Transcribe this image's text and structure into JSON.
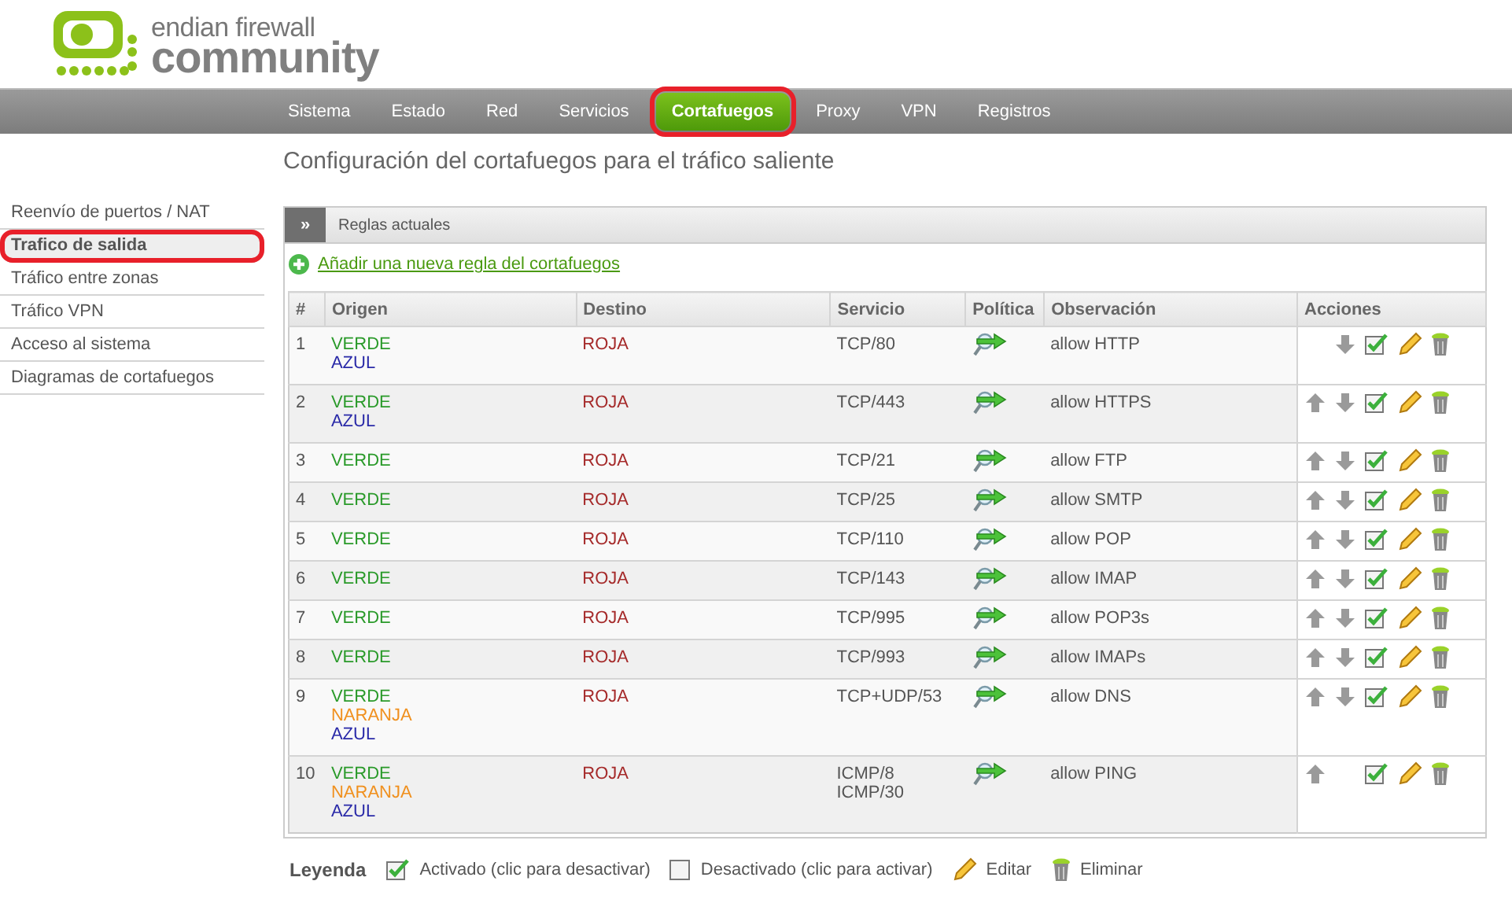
{
  "logo": {
    "line1": "endian firewall",
    "line2": "community"
  },
  "nav": [
    {
      "label": "Sistema",
      "selected": false,
      "highlighted": false
    },
    {
      "label": "Estado",
      "selected": false,
      "highlighted": false
    },
    {
      "label": "Red",
      "selected": false,
      "highlighted": false
    },
    {
      "label": "Servicios",
      "selected": false,
      "highlighted": false
    },
    {
      "label": "Cortafuegos",
      "selected": true,
      "highlighted": true
    },
    {
      "label": "Proxy",
      "selected": false,
      "highlighted": false
    },
    {
      "label": "VPN",
      "selected": false,
      "highlighted": false
    },
    {
      "label": "Registros",
      "selected": false,
      "highlighted": false
    }
  ],
  "page_title": "Configuración del cortafuegos para el tráfico saliente",
  "sidebar": [
    {
      "label": "Reenvío de puertos / NAT",
      "selected": false,
      "highlighted": false
    },
    {
      "label": "Trafico de salida",
      "selected": true,
      "highlighted": true
    },
    {
      "label": "Tráfico entre zonas",
      "selected": false,
      "highlighted": false
    },
    {
      "label": "Tráfico VPN",
      "selected": false,
      "highlighted": false
    },
    {
      "label": "Acceso al sistema",
      "selected": false,
      "highlighted": false
    },
    {
      "label": "Diagramas de cortafuegos",
      "selected": false,
      "highlighted": false
    }
  ],
  "panel": {
    "toggle": "»",
    "title": "Reglas actuales",
    "add_link": "Añadir una nueva regla del cortafuegos"
  },
  "table": {
    "columns": [
      "#",
      "Origen",
      "Destino",
      "Servicio",
      "Política",
      "Observación",
      "Acciones"
    ],
    "rows": [
      {
        "num": "1",
        "origin": [
          {
            "label": "VERDE",
            "color": "#2a9a2a"
          },
          {
            "label": "AZUL",
            "color": "#2a2aa8"
          }
        ],
        "destination": [
          {
            "label": "ROJA",
            "color": "#a52a2a"
          }
        ],
        "service": [
          "TCP/80"
        ],
        "note": "allow HTTP",
        "can_move_up": false,
        "can_move_down": true,
        "enabled": true
      },
      {
        "num": "2",
        "origin": [
          {
            "label": "VERDE",
            "color": "#2a9a2a"
          },
          {
            "label": "AZUL",
            "color": "#2a2aa8"
          }
        ],
        "destination": [
          {
            "label": "ROJA",
            "color": "#a52a2a"
          }
        ],
        "service": [
          "TCP/443"
        ],
        "note": "allow HTTPS",
        "can_move_up": true,
        "can_move_down": true,
        "enabled": true
      },
      {
        "num": "3",
        "origin": [
          {
            "label": "VERDE",
            "color": "#2a9a2a"
          }
        ],
        "destination": [
          {
            "label": "ROJA",
            "color": "#a52a2a"
          }
        ],
        "service": [
          "TCP/21"
        ],
        "note": "allow FTP",
        "can_move_up": true,
        "can_move_down": true,
        "enabled": true
      },
      {
        "num": "4",
        "origin": [
          {
            "label": "VERDE",
            "color": "#2a9a2a"
          }
        ],
        "destination": [
          {
            "label": "ROJA",
            "color": "#a52a2a"
          }
        ],
        "service": [
          "TCP/25"
        ],
        "note": "allow SMTP",
        "can_move_up": true,
        "can_move_down": true,
        "enabled": true
      },
      {
        "num": "5",
        "origin": [
          {
            "label": "VERDE",
            "color": "#2a9a2a"
          }
        ],
        "destination": [
          {
            "label": "ROJA",
            "color": "#a52a2a"
          }
        ],
        "service": [
          "TCP/110"
        ],
        "note": "allow POP",
        "can_move_up": true,
        "can_move_down": true,
        "enabled": true
      },
      {
        "num": "6",
        "origin": [
          {
            "label": "VERDE",
            "color": "#2a9a2a"
          }
        ],
        "destination": [
          {
            "label": "ROJA",
            "color": "#a52a2a"
          }
        ],
        "service": [
          "TCP/143"
        ],
        "note": "allow IMAP",
        "can_move_up": true,
        "can_move_down": true,
        "enabled": true
      },
      {
        "num": "7",
        "origin": [
          {
            "label": "VERDE",
            "color": "#2a9a2a"
          }
        ],
        "destination": [
          {
            "label": "ROJA",
            "color": "#a52a2a"
          }
        ],
        "service": [
          "TCP/995"
        ],
        "note": "allow POP3s",
        "can_move_up": true,
        "can_move_down": true,
        "enabled": true
      },
      {
        "num": "8",
        "origin": [
          {
            "label": "VERDE",
            "color": "#2a9a2a"
          }
        ],
        "destination": [
          {
            "label": "ROJA",
            "color": "#a52a2a"
          }
        ],
        "service": [
          "TCP/993"
        ],
        "note": "allow IMAPs",
        "can_move_up": true,
        "can_move_down": true,
        "enabled": true
      },
      {
        "num": "9",
        "origin": [
          {
            "label": "VERDE",
            "color": "#2a9a2a"
          },
          {
            "label": "NARANJA",
            "color": "#f0901e"
          },
          {
            "label": "AZUL",
            "color": "#2a2aa8"
          }
        ],
        "destination": [
          {
            "label": "ROJA",
            "color": "#a52a2a"
          }
        ],
        "service": [
          "TCP+UDP/53"
        ],
        "note": "allow DNS",
        "can_move_up": true,
        "can_move_down": true,
        "enabled": true
      },
      {
        "num": "10",
        "origin": [
          {
            "label": "VERDE",
            "color": "#2a9a2a"
          },
          {
            "label": "NARANJA",
            "color": "#f0901e"
          },
          {
            "label": "AZUL",
            "color": "#2a2aa8"
          }
        ],
        "destination": [
          {
            "label": "ROJA",
            "color": "#a52a2a"
          }
        ],
        "service": [
          "ICMP/8",
          "ICMP/30"
        ],
        "note": "allow PING",
        "can_move_up": true,
        "can_move_down": false,
        "enabled": true
      }
    ]
  },
  "legend": {
    "title": "Leyenda",
    "enabled": "Activado (clic para desactivar)",
    "disabled": "Desactivado (clic para activar)",
    "edit": "Editar",
    "delete": "Eliminar"
  }
}
